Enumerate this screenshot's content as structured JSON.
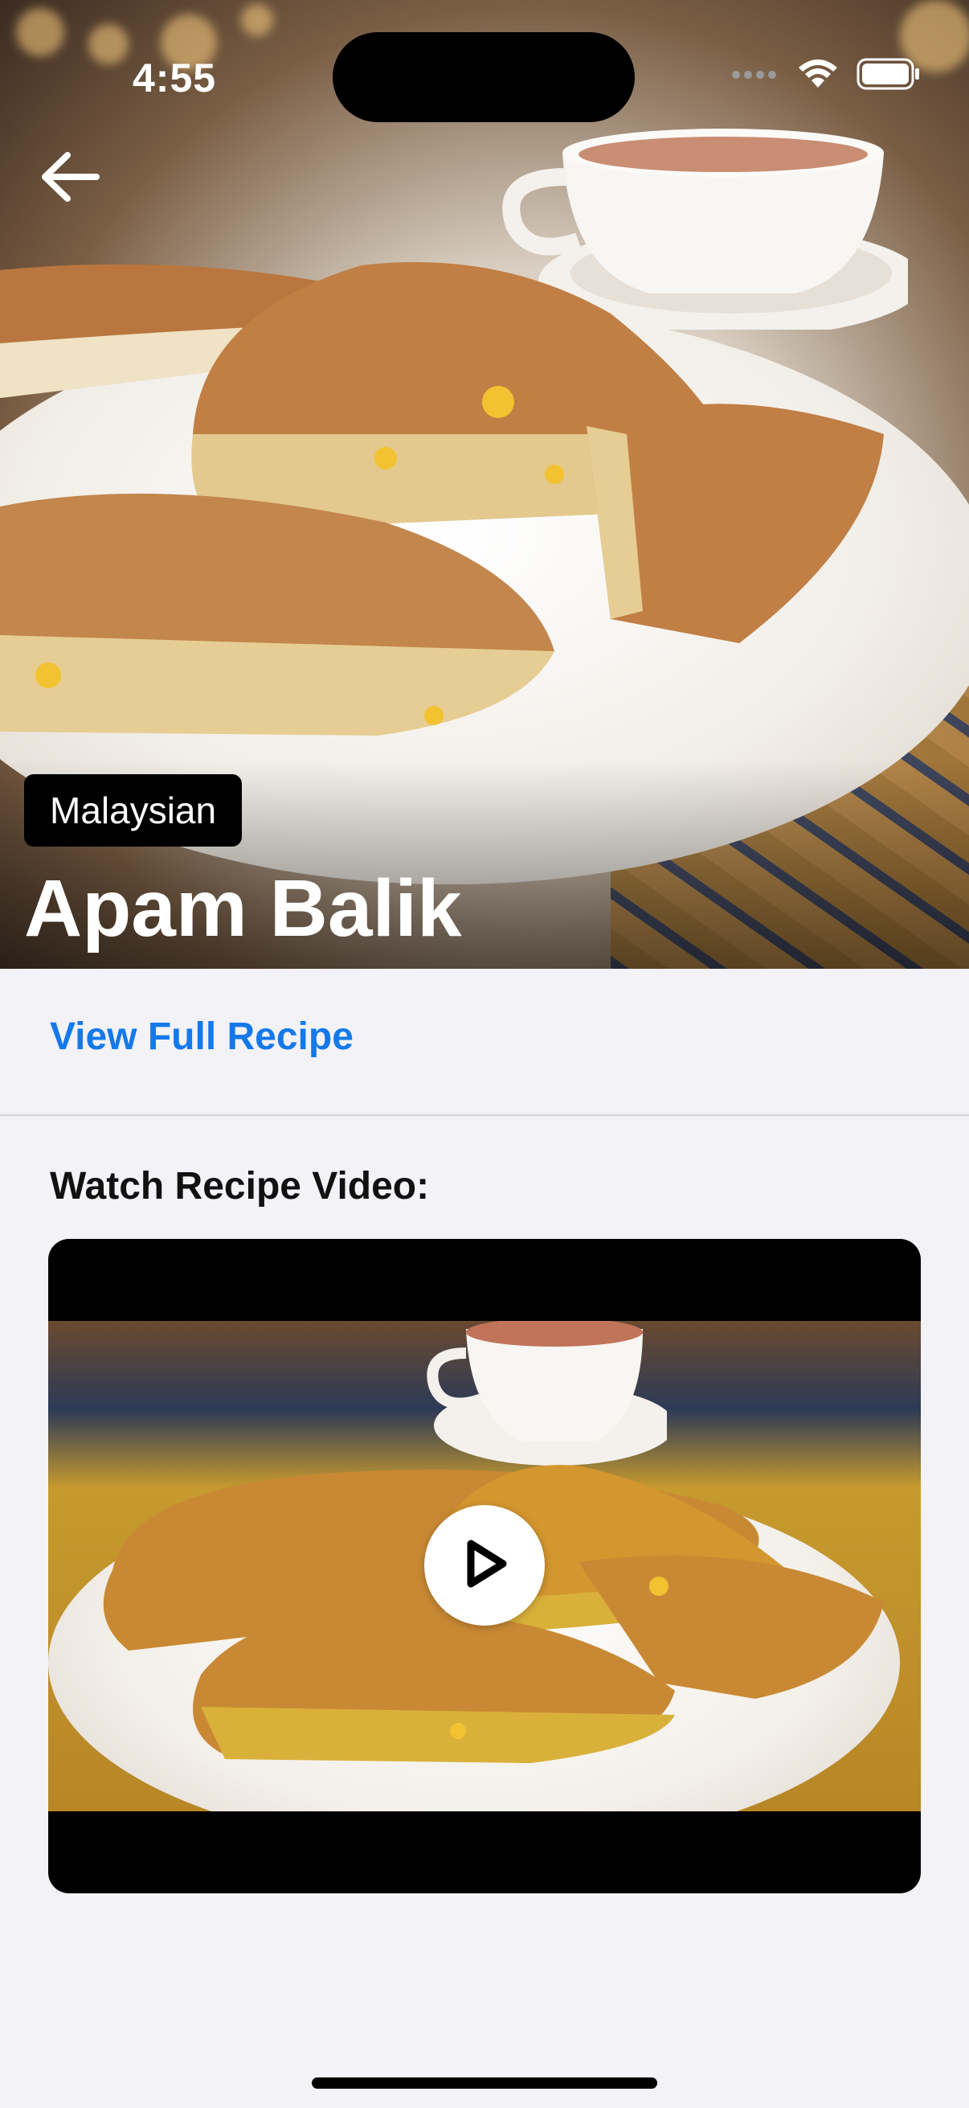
{
  "status_bar": {
    "time": "4:55"
  },
  "hero": {
    "cuisine_tag": "Malaysian",
    "title": "Apam Balik"
  },
  "actions": {
    "full_recipe_link": "View Full Recipe"
  },
  "video_section": {
    "label": "Watch Recipe Video:"
  },
  "icons": {
    "back": "arrow-left-icon",
    "play": "play-icon",
    "wifi": "wifi-icon",
    "battery": "battery-icon"
  },
  "colors": {
    "link": "#1479ea",
    "background": "#f2f2f7",
    "tag_bg": "#000000"
  }
}
